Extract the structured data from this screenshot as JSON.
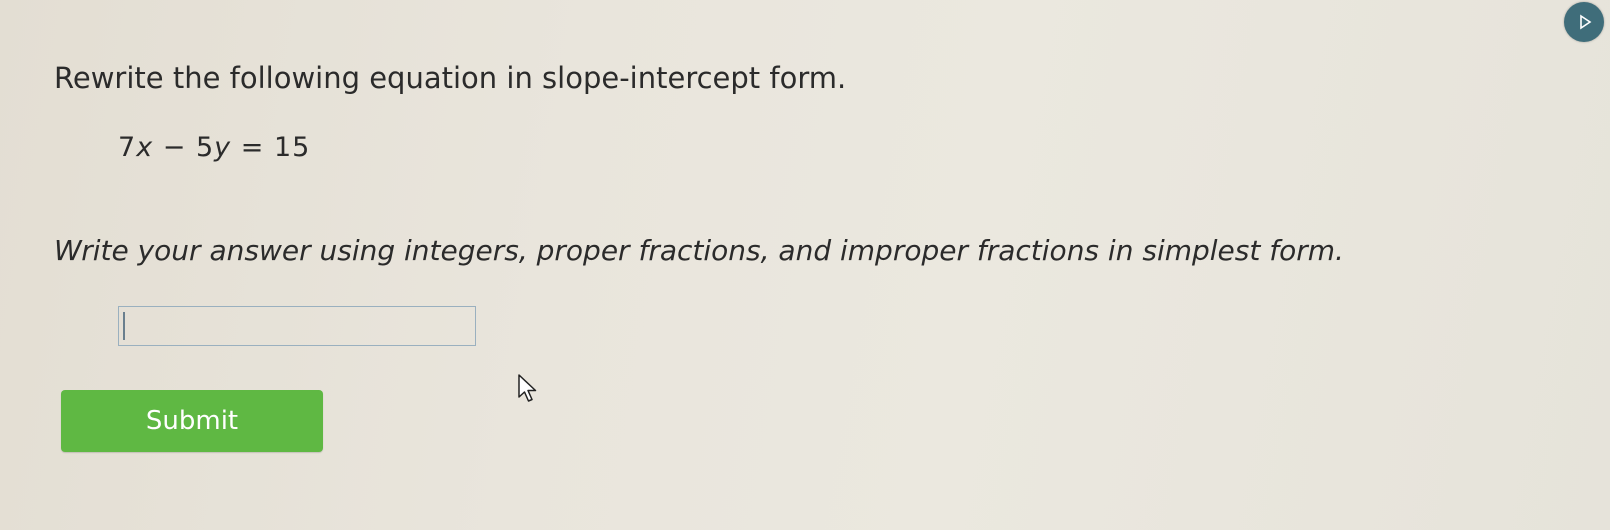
{
  "prompt": {
    "question": "Rewrite the following equation in slope-intercept form.",
    "equation": {
      "coef_x": "7",
      "var_x": "x",
      "operator": "−",
      "coef_y": "5",
      "var_y": "y",
      "equals": "=",
      "constant": "15"
    },
    "instructions": "Write your answer using integers, proper fractions, and improper fractions in simplest form."
  },
  "answer": {
    "value": "",
    "placeholder": ""
  },
  "actions": {
    "submit_label": "Submit"
  },
  "icons": {
    "corner": "play-icon",
    "pointer": "mouse-cursor-icon"
  },
  "colors": {
    "submit": "#5fb843",
    "corner_badge": "#3f6d7a",
    "input_border": "#9ab0bf"
  }
}
